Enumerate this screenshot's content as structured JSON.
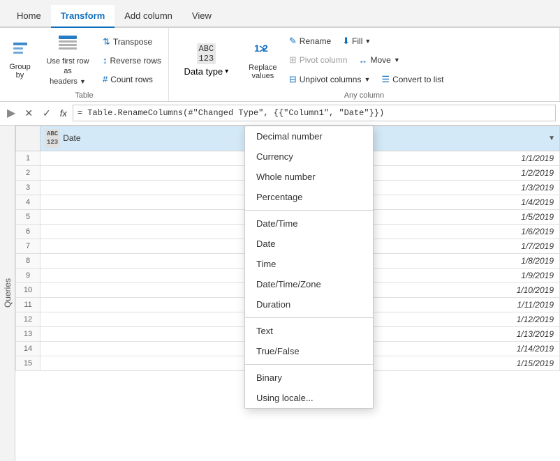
{
  "nav": {
    "tabs": [
      {
        "id": "home",
        "label": "Home",
        "active": false
      },
      {
        "id": "transform",
        "label": "Transform",
        "active": true
      },
      {
        "id": "add-column",
        "label": "Add column",
        "active": false
      },
      {
        "id": "view",
        "label": "View",
        "active": false
      }
    ]
  },
  "ribbon": {
    "groups": [
      {
        "id": "table",
        "label": "Table",
        "items": [
          {
            "id": "group-by",
            "label": "Group\nby",
            "type": "large"
          },
          {
            "id": "first-row",
            "label": "Use first row as\nheaders",
            "type": "large-with-arrow"
          }
        ],
        "small_items": [
          {
            "id": "transpose",
            "label": "Transpose"
          },
          {
            "id": "reverse-rows",
            "label": "Reverse rows"
          },
          {
            "id": "count-rows",
            "label": "Count rows"
          }
        ]
      },
      {
        "id": "any-column",
        "label": "Any column",
        "items": [
          {
            "id": "data-type",
            "label": "Data type",
            "type": "dropdown"
          },
          {
            "id": "replace-values",
            "label": "Replace\nvalues",
            "type": "large"
          },
          {
            "id": "rename",
            "label": "Rename",
            "type": "inline"
          },
          {
            "id": "fill",
            "label": "Fill",
            "type": "inline-dropdown"
          },
          {
            "id": "pivot-column",
            "label": "Pivot column",
            "type": "inline"
          },
          {
            "id": "move",
            "label": "Move",
            "type": "inline-dropdown"
          },
          {
            "id": "unpivot-columns",
            "label": "Unpivot columns",
            "type": "inline-dropdown"
          },
          {
            "id": "convert-to-list",
            "label": "Convert to list",
            "type": "inline"
          }
        ]
      }
    ]
  },
  "formula_bar": {
    "cancel_symbol": "✕",
    "confirm_symbol": "✓",
    "fx_label": "fx",
    "value": "= Table.RenameColumns(#\"Changed Type\", {{\"Column1\", \"Date\"}})"
  },
  "queries_label": "Queries",
  "grid": {
    "columns": [
      {
        "id": "row-num",
        "label": "",
        "type": ""
      },
      {
        "id": "date",
        "label": "Date",
        "type": "ABC\n123"
      }
    ],
    "rows": [
      {
        "num": 1,
        "date": "1/1/2019"
      },
      {
        "num": 2,
        "date": "1/2/2019"
      },
      {
        "num": 3,
        "date": "1/3/2019"
      },
      {
        "num": 4,
        "date": "1/4/2019"
      },
      {
        "num": 5,
        "date": "1/5/2019"
      },
      {
        "num": 6,
        "date": "1/6/2019"
      },
      {
        "num": 7,
        "date": "1/7/2019"
      },
      {
        "num": 8,
        "date": "1/8/2019"
      },
      {
        "num": 9,
        "date": "1/9/2019"
      },
      {
        "num": 10,
        "date": "1/10/2019"
      },
      {
        "num": 11,
        "date": "1/11/2019"
      },
      {
        "num": 12,
        "date": "1/12/2019"
      },
      {
        "num": 13,
        "date": "1/13/2019"
      },
      {
        "num": 14,
        "date": "1/14/2019"
      },
      {
        "num": 15,
        "date": "1/15/2019"
      }
    ]
  },
  "dropdown": {
    "title": "Data type",
    "items": [
      {
        "id": "decimal",
        "label": "Decimal number",
        "separator_after": false
      },
      {
        "id": "currency",
        "label": "Currency",
        "separator_after": false
      },
      {
        "id": "whole",
        "label": "Whole number",
        "separator_after": false
      },
      {
        "id": "percentage",
        "label": "Percentage",
        "separator_after": true
      },
      {
        "id": "datetime",
        "label": "Date/Time",
        "separator_after": false
      },
      {
        "id": "date",
        "label": "Date",
        "separator_after": false
      },
      {
        "id": "time",
        "label": "Time",
        "separator_after": false
      },
      {
        "id": "datetimezone",
        "label": "Date/Time/Zone",
        "separator_after": false
      },
      {
        "id": "duration",
        "label": "Duration",
        "separator_after": true
      },
      {
        "id": "text",
        "label": "Text",
        "separator_after": false
      },
      {
        "id": "true-false",
        "label": "True/False",
        "separator_after": true
      },
      {
        "id": "binary",
        "label": "Binary",
        "separator_after": false
      },
      {
        "id": "using-locale",
        "label": "Using locale...",
        "separator_after": false
      }
    ]
  }
}
